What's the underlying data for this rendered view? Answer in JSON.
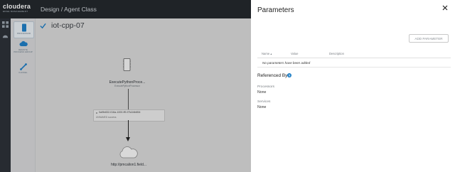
{
  "app": {
    "brand": "cloudera",
    "brand_sub": "EDGE MANAGEMENT",
    "breadcrumb": "Design / Agent Class"
  },
  "sidepanel": {
    "tools": [
      {
        "label": "PROCESSOR",
        "icon": "processor-icon"
      },
      {
        "label": "REMOTE PROCESS GROUP",
        "icon": "cloud-icon"
      },
      {
        "label": "FUNNEL",
        "icon": "funnel-icon"
      }
    ]
  },
  "canvas": {
    "flow_title": "iot-cpp-07",
    "processor": {
      "name": "ExecutePythonProce...",
      "subtitle": "ExecutePythonProcessor"
    },
    "connection": {
      "id": "0a9fe832-016a-1000-ff9-f7fc1fdb854",
      "sub": "UNNAMED   success"
    },
    "remote": {
      "url": "http://pmcalion1.field..."
    }
  },
  "drawer": {
    "title": "Parameters",
    "add_button": "ADD PARAMETER",
    "columns": [
      "Name ▴",
      "Value",
      "Description"
    ],
    "empty_text": "No parameters have been added",
    "referenced_by": "Referenced By",
    "processors_label": "Processors",
    "processors_value": "None",
    "services_label": "Services",
    "services_value": "None"
  },
  "colors": {
    "header": "#24282d",
    "rail": "#2d3238",
    "accent": "#1f7fc6"
  }
}
